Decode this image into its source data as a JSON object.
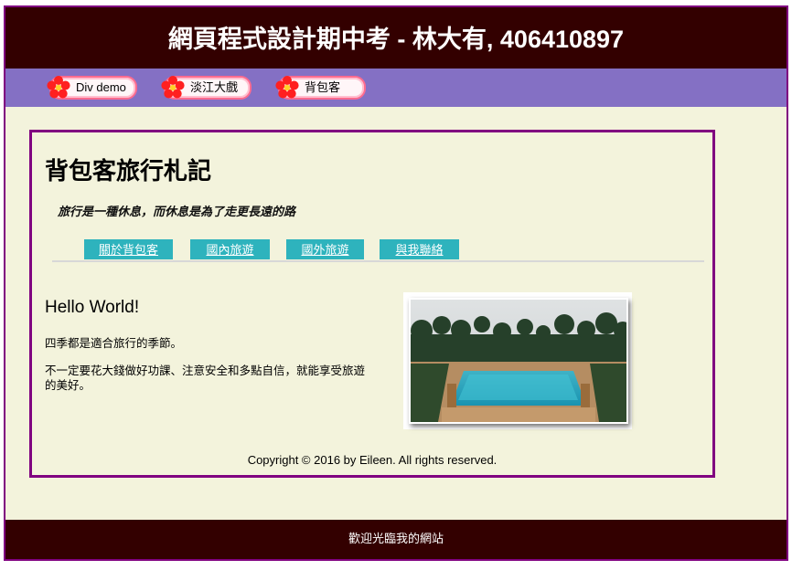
{
  "header": {
    "title": "網頁程式設計期中考 - 林大有, 406410897"
  },
  "menu": [
    {
      "label": "Div demo",
      "icon": "flower-icon"
    },
    {
      "label": "淡江大戲",
      "icon": "flower-icon"
    },
    {
      "label": "背包客",
      "icon": "flower-icon"
    }
  ],
  "site": {
    "title": "背包客旅行札記",
    "tagline": "旅行是一種休息，而休息是為了走更長遠的路"
  },
  "nav": [
    {
      "label": "關於背包客"
    },
    {
      "label": "國內旅遊"
    },
    {
      "label": "國外旅遊"
    },
    {
      "label": "與我聯絡"
    }
  ],
  "article": {
    "heading": "Hello World!",
    "paragraphs": [
      "四季都是適合旅行的季節。",
      "不一定要花大錢做好功課、注意安全和多點自信，就能享受旅遊的美好。"
    ]
  },
  "photo": {
    "subject": "resort swimming pool with palm trees"
  },
  "copyright": "Copyright © 2016 by Eileen. All rights reserved.",
  "footer": {
    "text": "歡迎光臨我的網站"
  },
  "colors": {
    "header_bg": "#330000",
    "menu_bg": "#8470c4",
    "page_bg": "#f3f3dc",
    "border": "#800080",
    "nav_bg": "#2eb3bd",
    "pill_border": "#ff6b8f"
  }
}
